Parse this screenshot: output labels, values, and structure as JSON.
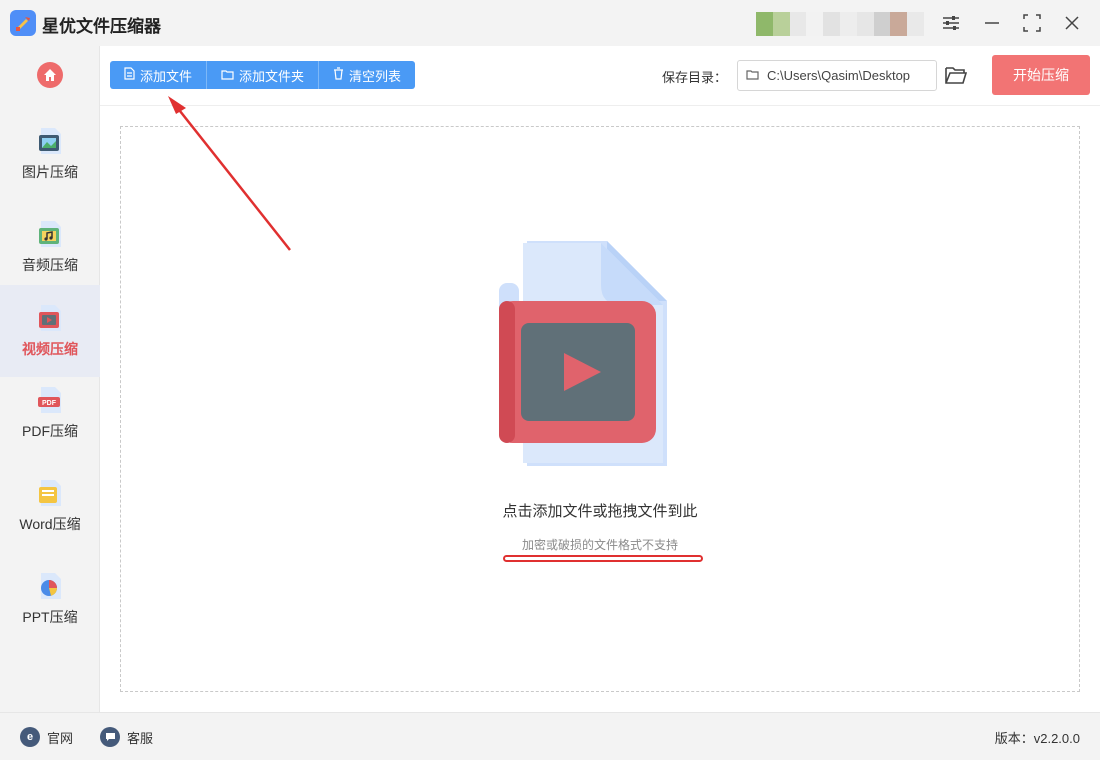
{
  "app": {
    "title": "星优文件压缩器"
  },
  "sidebar": {
    "items": [
      {
        "label": "图片压缩",
        "icon": "image-compress-icon"
      },
      {
        "label": "音频压缩",
        "icon": "audio-compress-icon"
      },
      {
        "label": "视频压缩",
        "icon": "video-compress-icon",
        "active": true
      },
      {
        "label": "PDF压缩",
        "icon": "pdf-compress-icon"
      },
      {
        "label": "Word压缩",
        "icon": "word-compress-icon"
      },
      {
        "label": "PPT压缩",
        "icon": "ppt-compress-icon"
      }
    ]
  },
  "toolbar": {
    "add_file": "添加文件",
    "add_folder": "添加文件夹",
    "clear_list": "清空列表",
    "save_label": "保存目录：",
    "save_path": "C:\\Users\\Qasim\\Desktop",
    "start": "开始压缩"
  },
  "dropzone": {
    "title": "点击添加文件或拖拽文件到此",
    "subtitle": "加密或破损的文件格式不支持"
  },
  "footer": {
    "website": "官网",
    "support": "客服",
    "version": "版本：v2.2.0.0"
  },
  "colors": {
    "accent_blue": "#4a9af5",
    "start_red": "#f27474",
    "active_red": "#e0565b",
    "annotation_red": "#e03030"
  }
}
